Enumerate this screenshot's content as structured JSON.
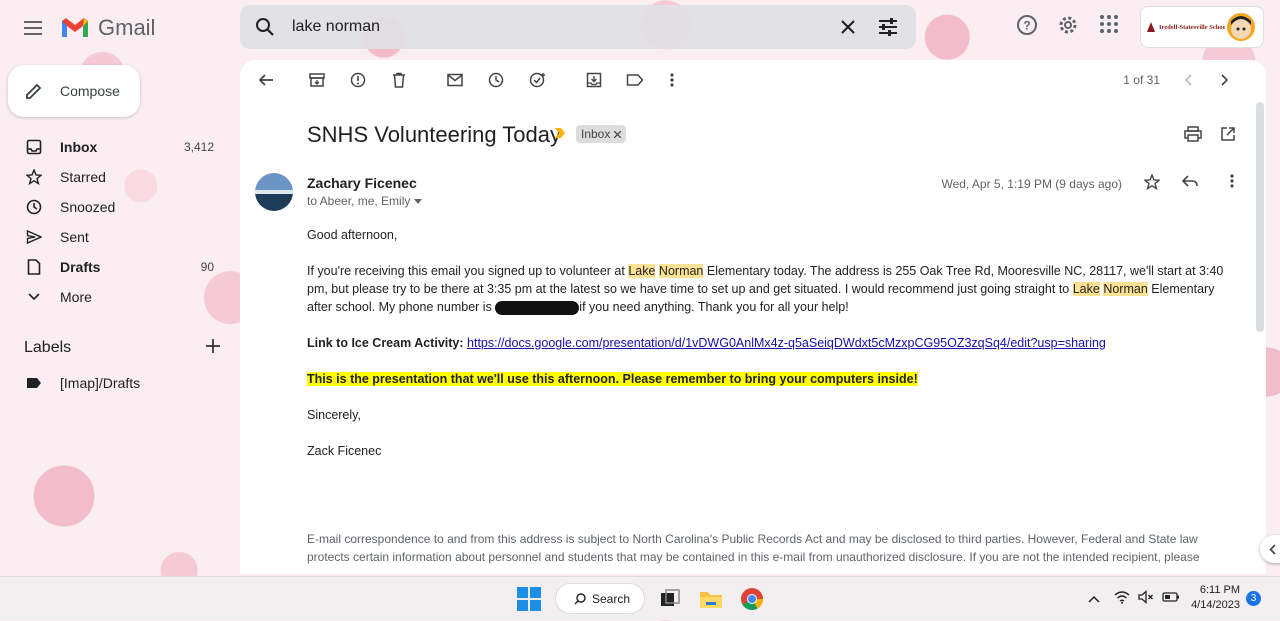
{
  "app": {
    "name": "Gmail"
  },
  "search": {
    "value": "lake norman"
  },
  "org": {
    "name": "Iredell-Statesville Schools"
  },
  "sidebar": {
    "compose_label": "Compose",
    "items": [
      {
        "label": "Inbox",
        "count": "3,412",
        "icon": "inbox-icon"
      },
      {
        "label": "Starred",
        "count": "",
        "icon": "star-icon"
      },
      {
        "label": "Snoozed",
        "count": "",
        "icon": "clock-icon"
      },
      {
        "label": "Sent",
        "count": "",
        "icon": "send-icon"
      },
      {
        "label": "Drafts",
        "count": "90",
        "icon": "draft-icon"
      },
      {
        "label": "More",
        "count": "",
        "icon": "chevron-down-icon"
      }
    ],
    "labels_title": "Labels",
    "labels": [
      {
        "label": "[Imap]/Drafts"
      }
    ]
  },
  "toolbar": {
    "pager": "1 of 31"
  },
  "email": {
    "subject": "SNHS Volunteering Today",
    "chip": "Inbox",
    "sender": "Zachary Ficenec",
    "recipients": "to Abeer, me, Emily",
    "date": "Wed, Apr 5, 1:19 PM (9 days ago)",
    "greeting": "Good afternoon,",
    "p1_a": "If you're receiving this email you signed up to volunteer at ",
    "hl_lake": "Lake",
    "hl_norman": "Norman",
    "p1_b": " Elementary today. The address is 255 Oak Tree Rd, Mooresville NC, 28117, we'll start at 3:40 pm, but please try to be there at 3:35 pm at the latest so we have time to set up and get situated. I would recommend just going straight to ",
    "p1_c": " Elementary after school. My phone number is ",
    "p1_d": "if you need anything. Thank you for all your help!",
    "link_label": "Link to Ice Cream Activity:",
    "link_url": "https://docs.google.com/presentation/d/1vDWG0AnlMx4z-q5aSeiqDWdxt5cMzxpCG95OZ3zqSq4/edit?usp=sharing",
    "highlight_line": "This is the presentation that we'll use this afternoon. Please remember to bring your computers inside!",
    "closing": "Sincerely,",
    "signature": "Zack Ficenec",
    "disclaimer": "E-mail correspondence to and from this address is subject to North Carolina's Public Records Act and may be disclosed to third parties. However, Federal and State law protects certain information about personnel and students that may be contained in this e-mail from unauthorized disclosure. If you are not the intended recipient, please"
  },
  "taskbar": {
    "search_label": "Search",
    "time": "6:11 PM",
    "date": "4/14/2023",
    "notifications": "3"
  },
  "colors": {
    "accent": "#1a73e8",
    "link": "#1a0dab",
    "highlight_search": "#fde293",
    "highlight_yellow": "#ffff00",
    "important_marker": "#f4b400"
  }
}
